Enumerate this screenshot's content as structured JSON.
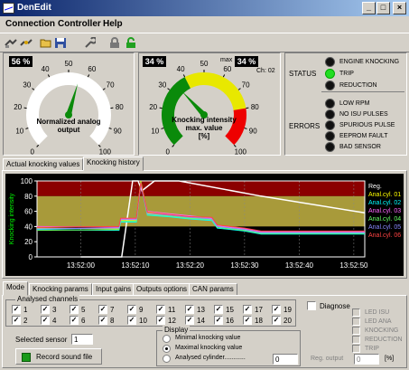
{
  "window": {
    "title": "DenEdit",
    "minimize": "_",
    "maximize": "□",
    "close": "×"
  },
  "menu": [
    "Connection",
    "Controller",
    "Help"
  ],
  "gauge1": {
    "value_box": "56 %",
    "label_line1": "Normalized analog",
    "label_line2": "output",
    "ticks": [
      "0",
      "10",
      "20",
      "30",
      "40",
      "50",
      "60",
      "70",
      "80",
      "90",
      "100"
    ],
    "value": 56
  },
  "gauge2": {
    "value_box": "34 %",
    "max_label": "max",
    "max_box": "34 %",
    "channel": "Ch: 02",
    "label_line1": "Knocking intensity",
    "label_line2": "max. value",
    "label_line3": "[%]",
    "ticks": [
      "0",
      "10",
      "20",
      "30",
      "40",
      "50",
      "60",
      "70",
      "80",
      "90",
      "100"
    ],
    "value": 34
  },
  "status": {
    "status_label": "STATUS",
    "errors_label": "ERRORS",
    "status_items": [
      {
        "label": "ENGINE KNOCKING",
        "on": false
      },
      {
        "label": "TRIP",
        "on": true
      },
      {
        "label": "REDUCTION",
        "on": false
      }
    ],
    "error_items": [
      {
        "label": "LOW RPM",
        "on": false
      },
      {
        "label": "NO ISU PULSES",
        "on": false
      },
      {
        "label": "SPURIOUS PULSE",
        "on": false
      },
      {
        "label": "EEPROM FAULT",
        "on": false
      },
      {
        "label": "BAD SENSOR",
        "on": false
      }
    ]
  },
  "top_tabs": [
    "Actual knocking values",
    "Knocking history"
  ],
  "chart_data": {
    "type": "line",
    "ylabel": "Knocking intensity",
    "ylim": [
      0,
      100
    ],
    "yticks": [
      "0",
      "20",
      "40",
      "60",
      "80",
      "100"
    ],
    "xticks": [
      "13:52:00",
      "13:52:10",
      "13:52:20",
      "13:52:30",
      "13:52:40",
      "13:52:50"
    ],
    "bands": [
      {
        "from": 80,
        "to": 100,
        "color": "#8b0000"
      },
      {
        "from": 40,
        "to": 80,
        "color": "#a89a3a"
      },
      {
        "from": 0,
        "to": 40,
        "color": "#000000"
      }
    ],
    "legend": [
      {
        "label": "Reg.",
        "color": "#ffffff"
      },
      {
        "label": "Anal.cyl. 01",
        "color": "#ffff00"
      },
      {
        "label": "Anal.cyl. 02",
        "color": "#00ffff"
      },
      {
        "label": "Anal.cyl. 03",
        "color": "#ff66ff"
      },
      {
        "label": "Anal.cyl. 04",
        "color": "#66ff66"
      },
      {
        "label": "Anal.cyl. 05",
        "color": "#8888ff"
      },
      {
        "label": "Anal.cyl. 06",
        "color": "#ff4444"
      }
    ],
    "series": [
      {
        "name": "Reg.",
        "color": "#ffffff",
        "points": [
          [
            0,
            0
          ],
          [
            7.5,
            0
          ],
          [
            9.5,
            100
          ],
          [
            10.5,
            100
          ],
          [
            11.2,
            87
          ],
          [
            13.5,
            100
          ],
          [
            18,
            100
          ],
          [
            33,
            80
          ],
          [
            52,
            58
          ]
        ]
      },
      {
        "name": "Anal.cyl. 01",
        "color": "#ffff00",
        "points": [
          [
            -8,
            38
          ],
          [
            7,
            37
          ],
          [
            7.3,
            48
          ],
          [
            10.2,
            48
          ],
          [
            11,
            100
          ],
          [
            12.2,
            58
          ],
          [
            16,
            56
          ],
          [
            20,
            52
          ],
          [
            24,
            50
          ],
          [
            25,
            40
          ],
          [
            30,
            36
          ],
          [
            33,
            32
          ],
          [
            52,
            32
          ]
        ]
      },
      {
        "name": "Anal.cyl. 02",
        "color": "#00ffff",
        "points": [
          [
            -8,
            36
          ],
          [
            7,
            35
          ],
          [
            7.3,
            46
          ],
          [
            10.2,
            46
          ],
          [
            11,
            97
          ],
          [
            12.2,
            55
          ],
          [
            16,
            53
          ],
          [
            20,
            50
          ],
          [
            24,
            48
          ],
          [
            25,
            38
          ],
          [
            30,
            34
          ],
          [
            33,
            30
          ],
          [
            52,
            30
          ]
        ]
      },
      {
        "name": "Anal.cyl. 03",
        "color": "#ff66ff",
        "points": [
          [
            -8,
            40
          ],
          [
            7,
            39
          ],
          [
            7.3,
            50
          ],
          [
            10.2,
            50
          ],
          [
            11,
            95
          ],
          [
            12.2,
            60
          ],
          [
            16,
            57
          ],
          [
            20,
            54
          ],
          [
            24,
            51
          ],
          [
            25,
            41
          ],
          [
            30,
            37
          ],
          [
            33,
            33
          ],
          [
            52,
            33
          ]
        ]
      },
      {
        "name": "Anal.cyl. 04",
        "color": "#66ff66",
        "points": [
          [
            -8,
            35
          ],
          [
            7,
            36
          ],
          [
            7.3,
            47
          ],
          [
            10.2,
            47
          ],
          [
            11,
            99
          ],
          [
            12.2,
            56
          ],
          [
            16,
            54
          ],
          [
            20,
            51
          ],
          [
            24,
            49
          ],
          [
            25,
            39
          ],
          [
            30,
            35
          ],
          [
            33,
            31
          ],
          [
            52,
            31
          ]
        ]
      },
      {
        "name": "Anal.cyl. 05",
        "color": "#8888ff",
        "points": [
          [
            -8,
            37
          ],
          [
            7,
            38
          ],
          [
            7.3,
            49
          ],
          [
            10.2,
            49
          ],
          [
            11,
            96
          ],
          [
            12.2,
            57
          ],
          [
            16,
            55
          ],
          [
            20,
            52
          ],
          [
            24,
            50
          ],
          [
            25,
            40
          ],
          [
            30,
            36
          ],
          [
            33,
            32
          ],
          [
            52,
            32
          ]
        ]
      },
      {
        "name": "Anal.cyl. 06",
        "color": "#ff4444",
        "points": [
          [
            -8,
            39
          ],
          [
            7,
            40
          ],
          [
            7.3,
            51
          ],
          [
            10.2,
            51
          ],
          [
            11,
            98
          ],
          [
            12.2,
            59
          ],
          [
            16,
            56
          ],
          [
            20,
            53
          ],
          [
            24,
            52
          ],
          [
            25,
            42
          ],
          [
            30,
            38
          ],
          [
            33,
            34
          ],
          [
            52,
            34
          ]
        ]
      }
    ]
  },
  "bottom_tabs": [
    "Mode",
    "Knocking params",
    "Input gains",
    "Outputs options",
    "CAN params"
  ],
  "channels": {
    "legend": "Analysed channels",
    "items": [
      {
        "n": "1",
        "checked": true
      },
      {
        "n": "3",
        "checked": true
      },
      {
        "n": "5",
        "checked": true
      },
      {
        "n": "7",
        "checked": true
      },
      {
        "n": "9",
        "checked": true
      },
      {
        "n": "11",
        "checked": true
      },
      {
        "n": "13",
        "checked": true
      },
      {
        "n": "15",
        "checked": true
      },
      {
        "n": "17",
        "checked": true
      },
      {
        "n": "19",
        "checked": true
      },
      {
        "n": "2",
        "checked": true
      },
      {
        "n": "4",
        "checked": true
      },
      {
        "n": "6",
        "checked": true
      },
      {
        "n": "8",
        "checked": true
      },
      {
        "n": "10",
        "checked": true
      },
      {
        "n": "12",
        "checked": true
      },
      {
        "n": "14",
        "checked": true
      },
      {
        "n": "16",
        "checked": true
      },
      {
        "n": "18",
        "checked": true
      },
      {
        "n": "20",
        "checked": true
      }
    ]
  },
  "sensor": {
    "label": "Selected sensor",
    "value": "1"
  },
  "record": {
    "label": "Record sound file"
  },
  "display": {
    "legend": "Display",
    "options": [
      {
        "label": "Minimal knocking value",
        "selected": false
      },
      {
        "label": "Maximal knocking value",
        "selected": true
      },
      {
        "label": "Analysed cylinder............",
        "selected": false
      }
    ],
    "cyl_value": "0"
  },
  "diagnose": {
    "label": "Diagnose",
    "items": [
      "LED ISU",
      "LED ANA",
      "KNOCKING",
      "REDUCTION",
      "TRIP"
    ],
    "reg_label": "Reg. output",
    "reg_value": "0",
    "unit": "[%]"
  }
}
